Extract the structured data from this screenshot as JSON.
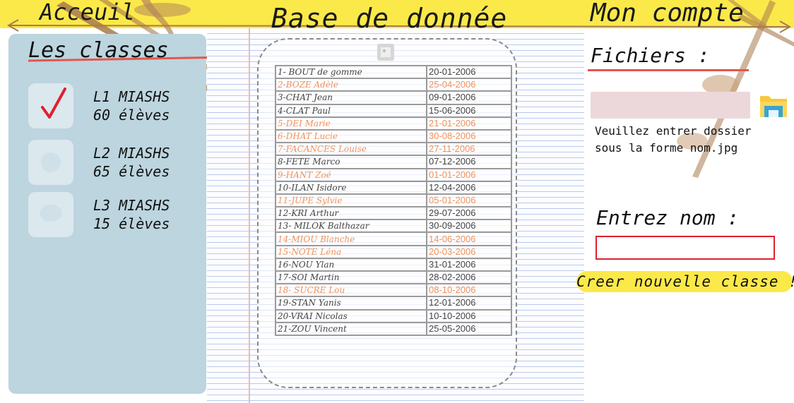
{
  "nav": {
    "home": "Acceuil",
    "database": "Base de donnée",
    "account": "Mon compte"
  },
  "left_panel": {
    "title": "Les classes",
    "classes": [
      {
        "name": "L1 MIASHS",
        "count": "60 élèves",
        "checked": true
      },
      {
        "name": "L2 MIASHS",
        "count": "65 élèves",
        "checked": false
      },
      {
        "name": "L3 MIASHS",
        "count": "15 élèves",
        "checked": false
      }
    ]
  },
  "table": {
    "rows": [
      {
        "name": "1- BOUT de gomme",
        "date": "20-01-2006",
        "highlight": false
      },
      {
        "name": "2-BOZE Adèle",
        "date": "25-04-2006",
        "highlight": true
      },
      {
        "name": "3-CHAT Jean",
        "date": "09-01-2006",
        "highlight": false
      },
      {
        "name": "4-CLAT Paul",
        "date": "15-06-2006",
        "highlight": false
      },
      {
        "name": "5-DEI Marie",
        "date": "21-01-2006",
        "highlight": true
      },
      {
        "name": "6-DHAT Lucie",
        "date": "30-08-2006",
        "highlight": true
      },
      {
        "name": "7-FACANCES Louise",
        "date": "27-11-2006",
        "highlight": true
      },
      {
        "name": "8-FETE Marco",
        "date": "07-12-2006",
        "highlight": false
      },
      {
        "name": "9-HANT Zoé",
        "date": "01-01-2006",
        "highlight": true
      },
      {
        "name": "10-ILAN Isidore",
        "date": "12-04-2006",
        "highlight": false
      },
      {
        "name": "11-JUPE Sylvie",
        "date": "05-01-2006",
        "highlight": true
      },
      {
        "name": "12-KRI Arthur",
        "date": "29-07-2006",
        "highlight": false
      },
      {
        "name": "13- MILOK Balthazar",
        "date": "30-09-2006",
        "highlight": false
      },
      {
        "name": "14-MIOU Blanche",
        "date": "14-06-2006",
        "highlight": true
      },
      {
        "name": "15-NOTE Léna",
        "date": "20-03-2006",
        "highlight": true
      },
      {
        "name": "16-NOU Ylan",
        "date": "31-01-2006",
        "highlight": false
      },
      {
        "name": "17-SOI Martin",
        "date": "28-02-2006",
        "highlight": false
      },
      {
        "name": "18- SUCRE Lou",
        "date": "08-10-2006",
        "highlight": true
      },
      {
        "name": "19-STAN Yanis",
        "date": "12-01-2006",
        "highlight": false
      },
      {
        "name": "20-VRAI Nicolas",
        "date": "10-10-2006",
        "highlight": false
      },
      {
        "name": "21-ZOU Vincent",
        "date": "25-05-2006",
        "highlight": false
      }
    ]
  },
  "account": {
    "files_title": "Fichiers :",
    "files_help": "Veuillez entrer dossier sous la forme nom.jpg",
    "name_title": "Entrez nom  :",
    "create_button": "Creer nouvelle classe !"
  },
  "colors": {
    "yellow": "#fbe94a",
    "panel_blue": "#bcd5df",
    "accent_red": "#e2574c",
    "highlight_orange": "#f0925a",
    "input_border": "#e0202e"
  },
  "icons": {
    "check": "check-icon",
    "folder": "folder-icon",
    "image": "image-icon"
  }
}
